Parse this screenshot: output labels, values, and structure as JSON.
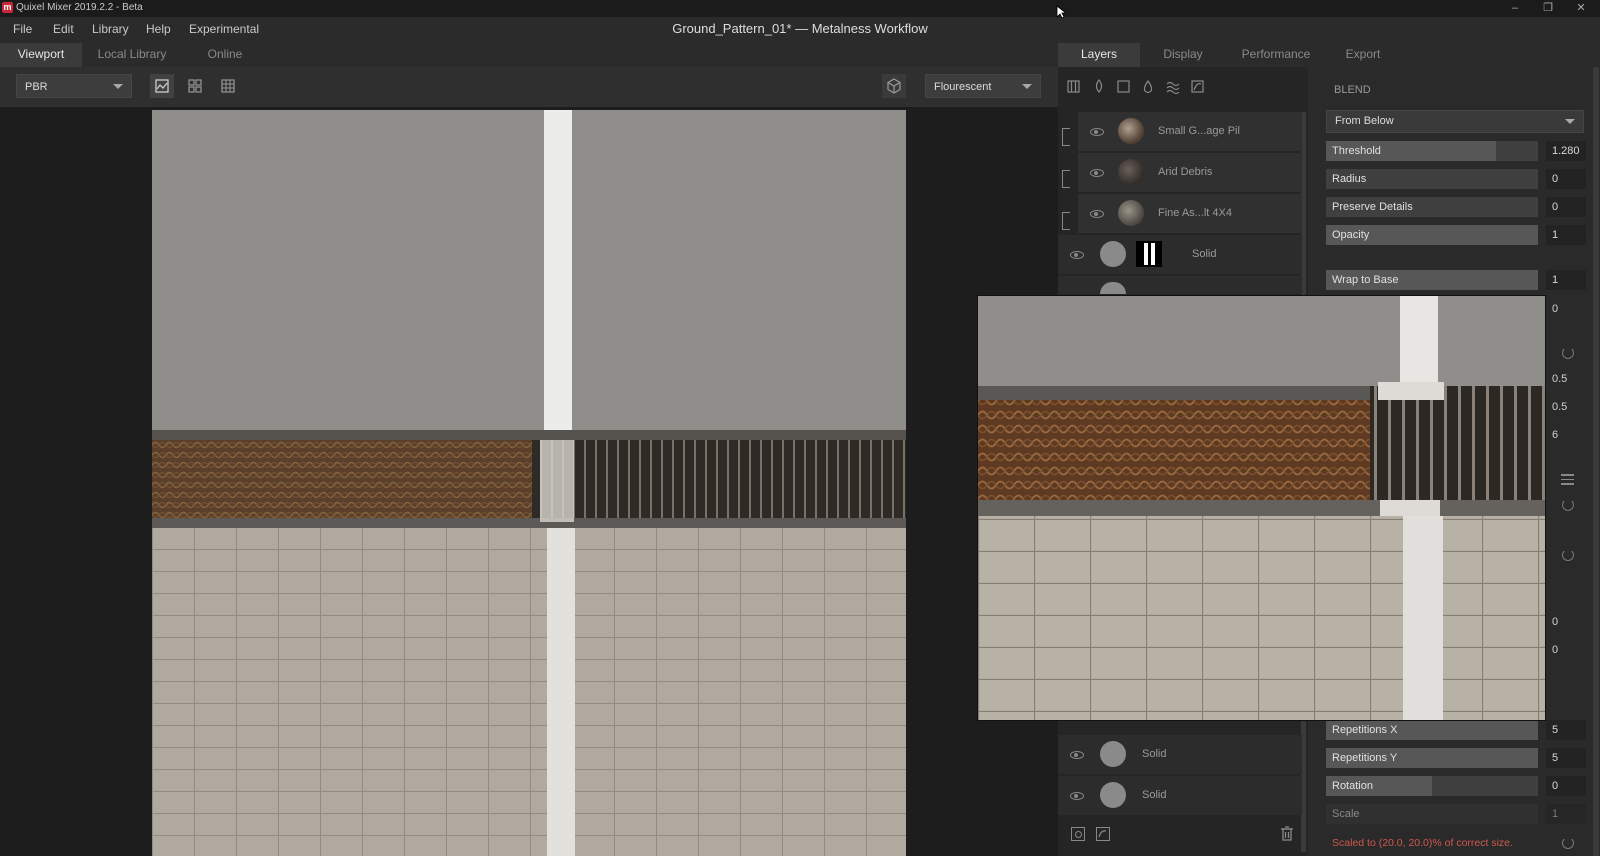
{
  "window": {
    "app_title": "Quixel Mixer 2019.2.2 - Beta",
    "document_title": "Ground_Pattern_01* — Metalness Workflow",
    "controls": [
      "–",
      "❐",
      "✕"
    ]
  },
  "menu": [
    "File",
    "Edit",
    "Library",
    "Help",
    "Experimental"
  ],
  "left_tabs": [
    {
      "label": "Viewport",
      "active": true
    },
    {
      "label": "Local Library",
      "active": false
    },
    {
      "label": "Online",
      "active": false
    }
  ],
  "right_tabs": [
    {
      "label": "Layers",
      "active": true
    },
    {
      "label": "Display",
      "active": false
    },
    {
      "label": "Performance",
      "active": false
    },
    {
      "label": "Export",
      "active": false
    }
  ],
  "toolbar": {
    "render_mode": "PBR",
    "view_icons": [
      "image-view-icon",
      "split-view-icon",
      "grid-view-icon"
    ],
    "mesh_icon": "cube-icon",
    "lighting": "Flourescent"
  },
  "layer_tools": [
    "pattern-icon",
    "leaf-icon",
    "square-icon",
    "drop-icon",
    "waves-icon",
    "curve-icon"
  ],
  "layers": [
    {
      "name": "Small G...age Pil",
      "thumb": "#5a4a3c",
      "clipped": true
    },
    {
      "name": "Arid Debris",
      "thumb": "#3a3330",
      "clipped": true
    },
    {
      "name": "Fine As...lt 4X4",
      "thumb": "#55504a",
      "clipped": true
    },
    {
      "name": "Solid",
      "thumb": "#8a8a8a",
      "clipped": false,
      "mask": true
    }
  ],
  "bottom_layers": [
    {
      "name": "Solid"
    },
    {
      "name": "Solid"
    }
  ],
  "blend": {
    "section_title": "BLEND",
    "mode": "From Below",
    "properties": [
      {
        "label": "Threshold",
        "value": "1.280",
        "fill": 0.8
      },
      {
        "label": "Radius",
        "value": "0",
        "fill": 0
      },
      {
        "label": "Preserve Details",
        "value": "0",
        "fill": 0
      },
      {
        "label": "Opacity",
        "value": "1",
        "fill": 1.0
      }
    ],
    "wrap": {
      "label": "Wrap to Base",
      "value": "1",
      "fill": 1.0
    }
  },
  "hidden_values": [
    "0",
    "0.5",
    "0.5",
    "6",
    "0",
    "0"
  ],
  "transform": [
    {
      "label": "Repetitions X",
      "value": "5",
      "fill": 1.0
    },
    {
      "label": "Repetitions Y",
      "value": "5",
      "fill": 1.0
    },
    {
      "label": "Rotation",
      "value": "0",
      "fill": 0.5
    },
    {
      "label": "Scale",
      "value": "1",
      "fill": 0
    }
  ],
  "status": "Scaled to (20.0, 20.0)% of correct size."
}
